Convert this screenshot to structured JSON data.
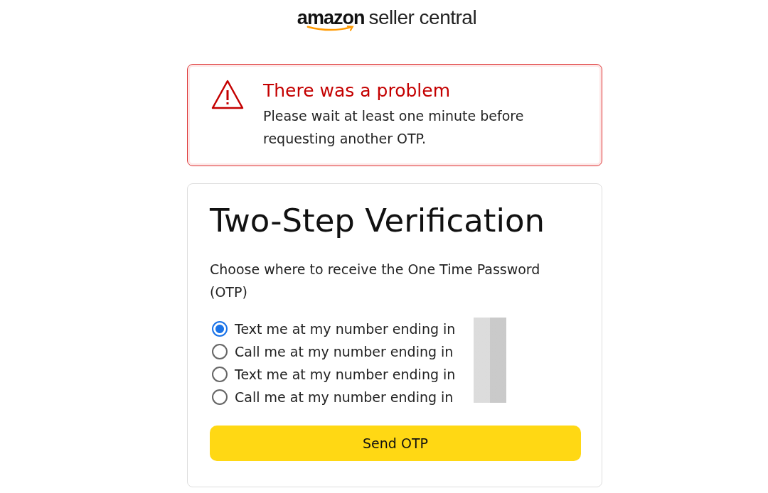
{
  "logo": {
    "brand": "amazon",
    "product": "seller central"
  },
  "alert": {
    "title": "There was a problem",
    "message": "Please wait at least one minute before requesting another OTP."
  },
  "card": {
    "title": "Two-Step Verification",
    "prompt": "Choose where to receive the One Time Password (OTP)",
    "options": [
      {
        "label": "Text me at my number ending in",
        "selected": true
      },
      {
        "label": "Call me at my number ending in",
        "selected": false
      },
      {
        "label": "Text me at my number ending in",
        "selected": false
      },
      {
        "label": "Call me at my number ending in",
        "selected": false
      }
    ],
    "button": "Send OTP"
  }
}
